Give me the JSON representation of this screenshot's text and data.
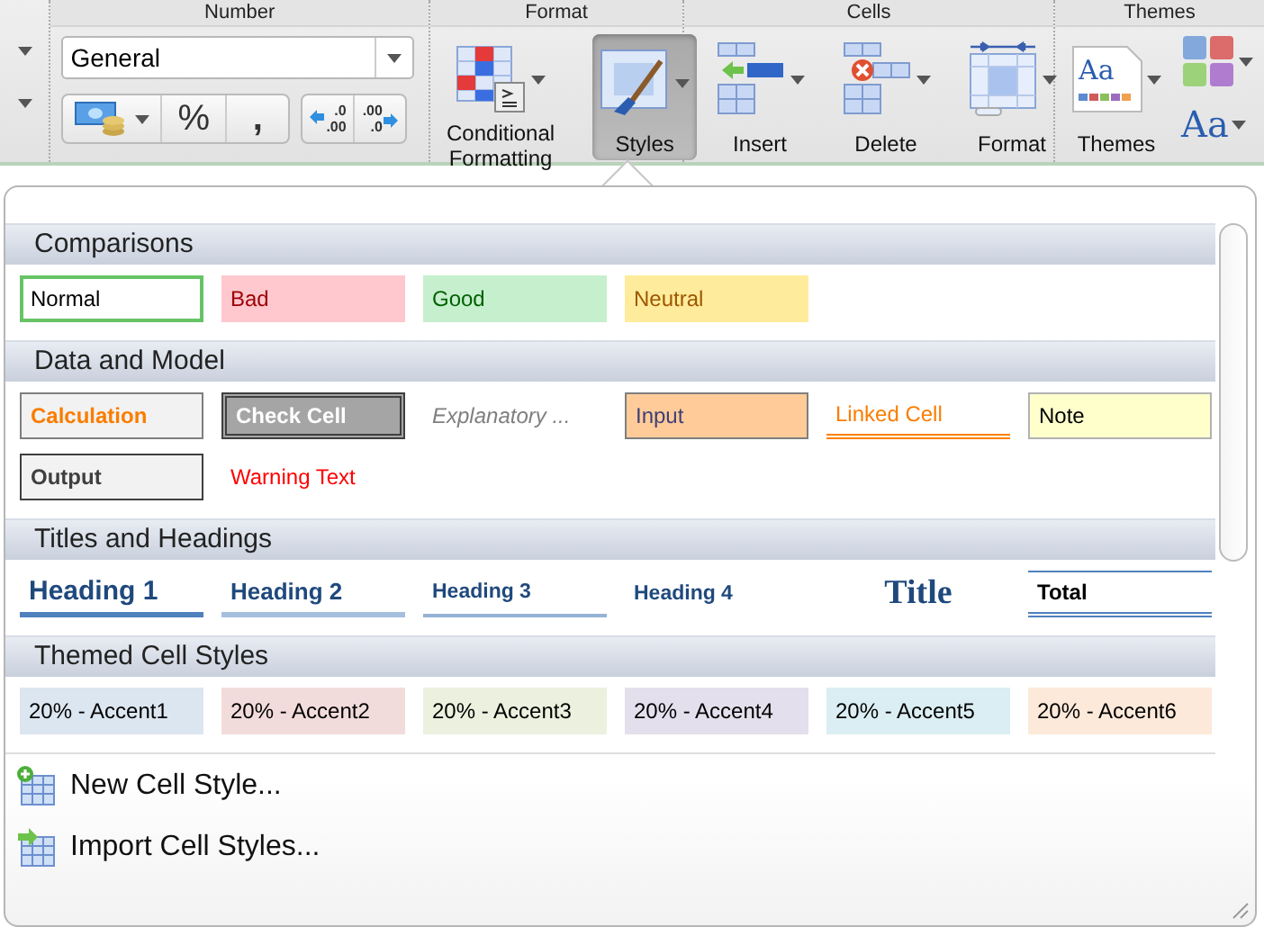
{
  "ribbon": {
    "number": {
      "title": "Number",
      "format_field": {
        "value": "General"
      },
      "percent": "%",
      "comma": ",",
      "increase_decimal": {
        "top": ".0",
        "bottom": ".00"
      },
      "decrease_decimal": {
        "top": ".00",
        "bottom": ".0"
      }
    },
    "format": {
      "title": "Format",
      "buttons": [
        {
          "label": "Conditional Formatting",
          "kind": "conditional",
          "selected": false
        },
        {
          "label": "Styles",
          "kind": "styles",
          "selected": true
        }
      ]
    },
    "cells": {
      "title": "Cells",
      "buttons": [
        {
          "label": "Insert",
          "kind": "insert"
        },
        {
          "label": "Delete",
          "kind": "delete"
        },
        {
          "label": "Format",
          "kind": "format"
        }
      ]
    },
    "themes": {
      "title": "Themes",
      "themes_button": {
        "label": "Themes",
        "icon_text": "Aa"
      },
      "fonts_button": {
        "icon_text": "Aa"
      }
    }
  },
  "styles_gallery": {
    "sections": [
      {
        "title": "Comparisons",
        "styles": [
          {
            "label": "Normal",
            "kind": "normal",
            "selected": true
          },
          {
            "label": "Bad",
            "kind": "bad",
            "selected": false
          },
          {
            "label": "Good",
            "kind": "good",
            "selected": false
          },
          {
            "label": "Neutral",
            "kind": "neutral",
            "selected": false
          }
        ]
      },
      {
        "title": "Data and Model",
        "styles": [
          {
            "label": "Calculation",
            "kind": "calculation",
            "selected": false
          },
          {
            "label": "Check Cell",
            "kind": "check",
            "selected": false
          },
          {
            "label": "Explanatory ...",
            "kind": "explanatory",
            "selected": false
          },
          {
            "label": "Input",
            "kind": "input",
            "selected": false
          },
          {
            "label": "Linked Cell",
            "kind": "linked",
            "selected": false
          },
          {
            "label": "Note",
            "kind": "note",
            "selected": false
          },
          {
            "label": "Output",
            "kind": "output",
            "selected": false
          },
          {
            "label": "Warning Text",
            "kind": "warning",
            "selected": false
          }
        ]
      },
      {
        "title": "Titles and Headings",
        "styles": [
          {
            "label": "Heading 1",
            "kind": "heading1",
            "selected": false
          },
          {
            "label": "Heading 2",
            "kind": "heading2",
            "selected": false
          },
          {
            "label": "Heading 3",
            "kind": "heading3",
            "selected": false
          },
          {
            "label": "Heading 4",
            "kind": "heading4",
            "selected": false
          },
          {
            "label": "Title",
            "kind": "title",
            "selected": false
          },
          {
            "label": "Total",
            "kind": "total",
            "selected": false
          }
        ]
      },
      {
        "title": "Themed Cell Styles",
        "styles": [
          {
            "label": "20% - Accent1",
            "kind": "accent1",
            "selected": false
          },
          {
            "label": "20% - Accent2",
            "kind": "accent2",
            "selected": false
          },
          {
            "label": "20% - Accent3",
            "kind": "accent3",
            "selected": false
          },
          {
            "label": "20% - Accent4",
            "kind": "accent4",
            "selected": false
          },
          {
            "label": "20% - Accent5",
            "kind": "accent5",
            "selected": false
          },
          {
            "label": "20% - Accent6",
            "kind": "accent6",
            "selected": false
          }
        ]
      }
    ],
    "actions": [
      {
        "label": "New Cell Style...",
        "kind": "new"
      },
      {
        "label": "Import Cell Styles...",
        "kind": "import"
      }
    ]
  }
}
